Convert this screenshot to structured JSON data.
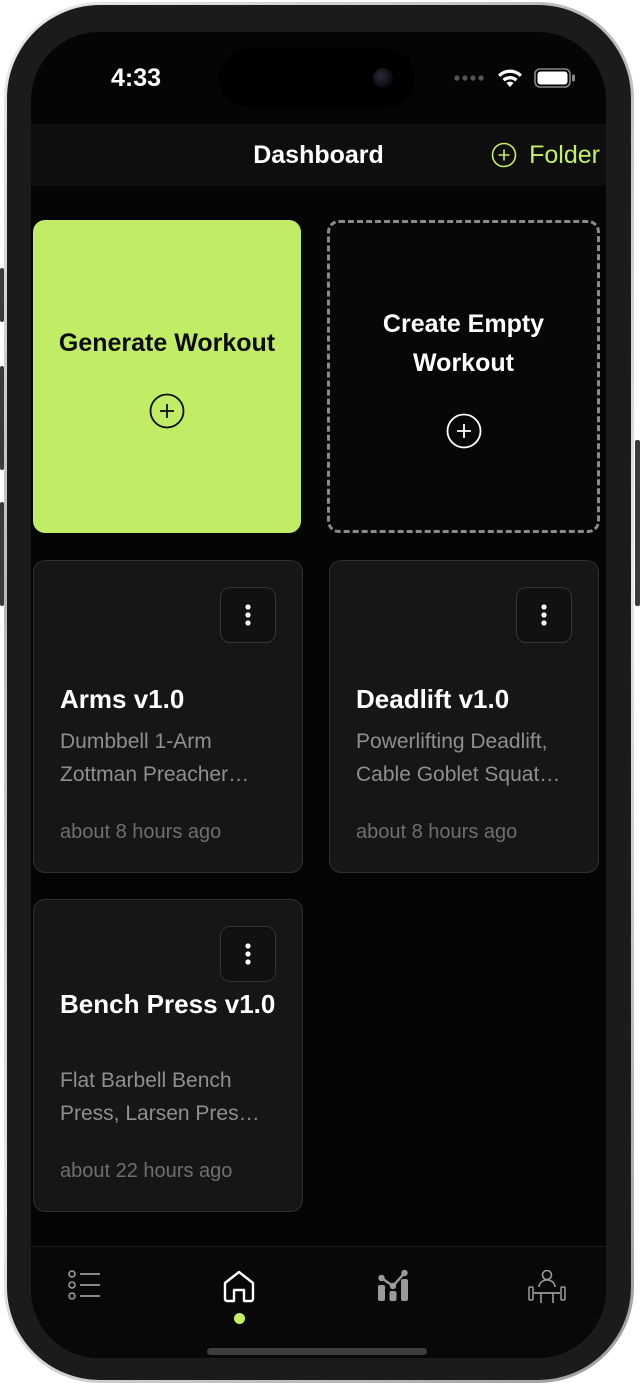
{
  "status_bar": {
    "time": "4:33"
  },
  "nav": {
    "title": "Dashboard",
    "folder_label": "Folder"
  },
  "actions": {
    "generate_label": "Generate Workout",
    "empty_label": "Create Empty Workout"
  },
  "workouts": [
    {
      "title": "Arms v1.0",
      "description": "Dumbbell 1-Arm Zottman Preacher…",
      "time": "about 8 hours ago"
    },
    {
      "title": "Deadlift v1.0",
      "description": "Powerlifting Deadlift, Cable Goblet Squat…",
      "time": "about 8 hours ago"
    },
    {
      "title": "Bench Press v1.0",
      "description": "Flat Barbell Bench Press, Larsen Pres…",
      "time": "about 22 hours ago"
    }
  ],
  "tabs": [
    {
      "icon": "list-icon",
      "active": false
    },
    {
      "icon": "home-icon",
      "active": true
    },
    {
      "icon": "stats-icon",
      "active": false
    },
    {
      "icon": "gym-icon",
      "active": false
    }
  ],
  "colors": {
    "accent": "#c4ef66",
    "card_green": "#c1ec65",
    "background": "#050505"
  }
}
